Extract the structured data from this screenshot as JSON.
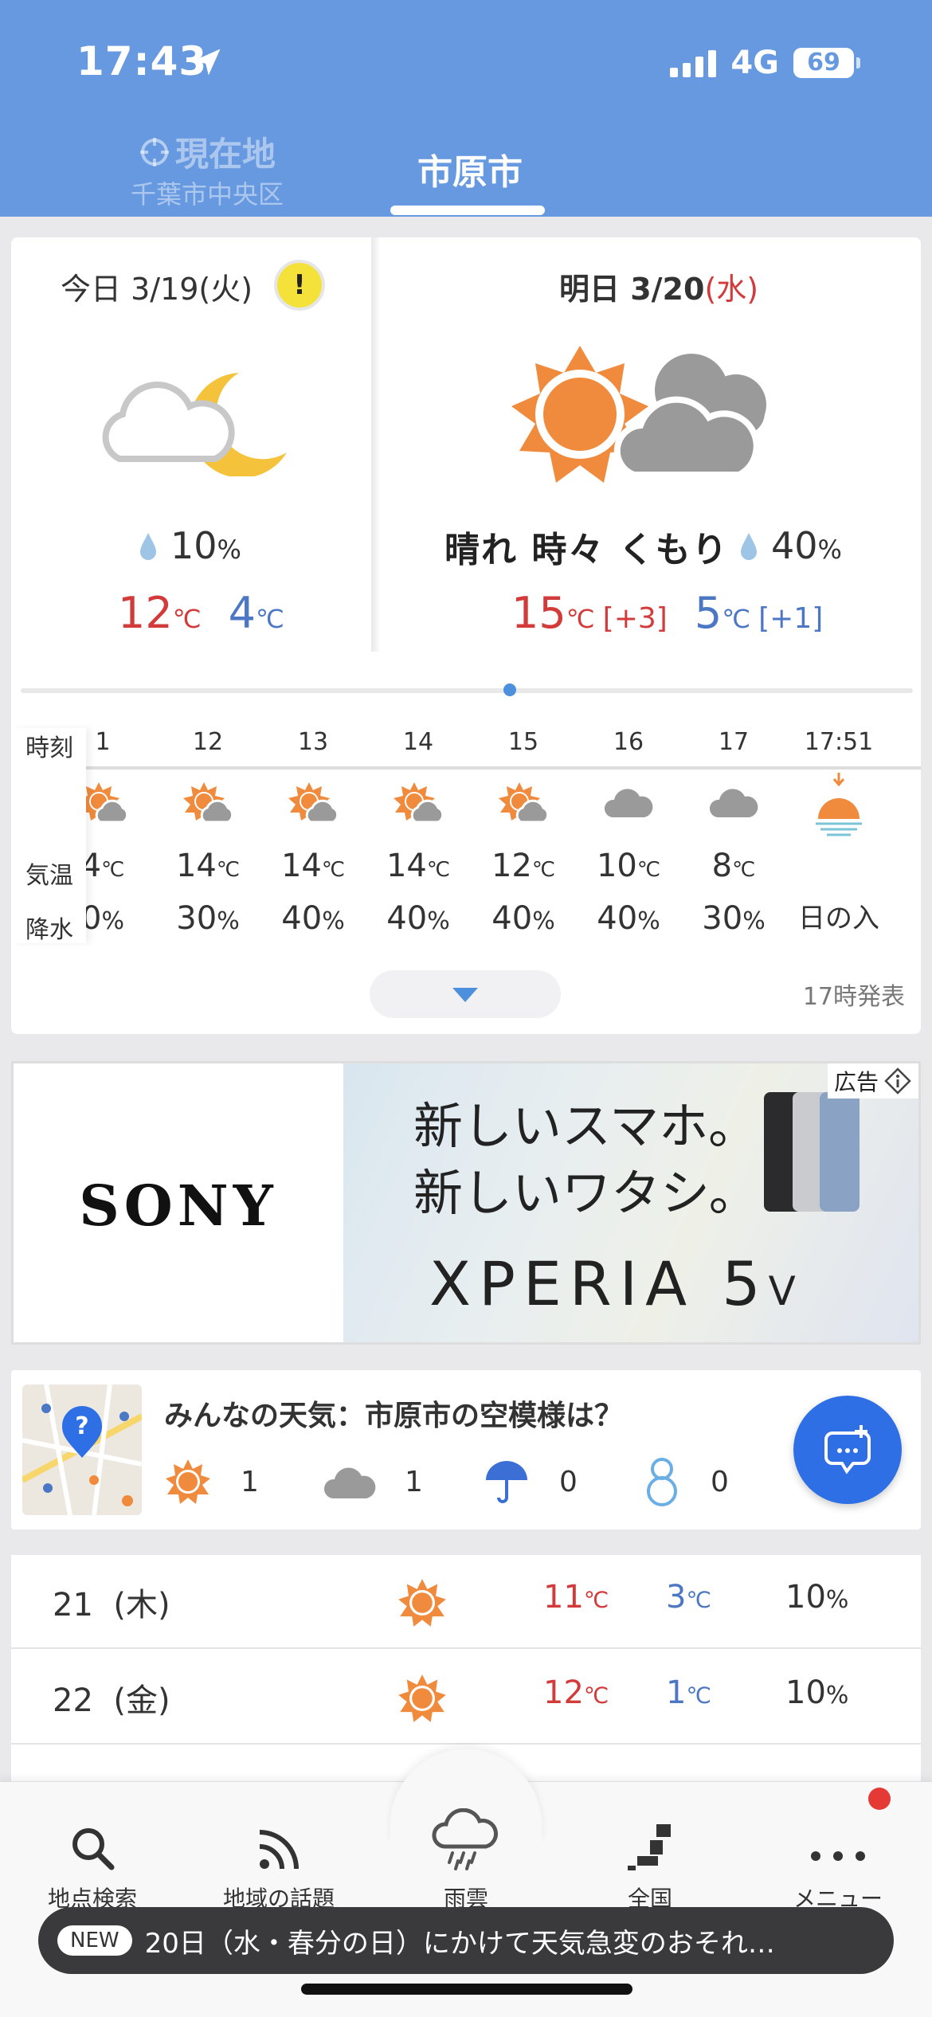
{
  "status_bar": {
    "time": "17:43",
    "network": "4G",
    "battery": "69"
  },
  "tabs": {
    "current_location_label": "現在地",
    "current_location_area": "千葉市中央区",
    "city_label": "市原市"
  },
  "today": {
    "date": "今日 3/19",
    "weekday": "(火)",
    "warning_mark": "!",
    "pop": "10",
    "pop_unit": "%",
    "high": "12",
    "low": "4",
    "temp_unit": "℃"
  },
  "tomorrow": {
    "date": "明日 3/20",
    "weekday": "(水)",
    "weather": "晴れ 時々 くもり",
    "pop": "40",
    "pop_unit": "%",
    "high": "15",
    "high_diff": "[+3]",
    "low": "5",
    "low_diff": "[+1]",
    "temp_unit": "℃"
  },
  "hourly": {
    "row_labels": {
      "time": "時刻",
      "temp": "気温",
      "precip": "降水"
    },
    "columns": [
      {
        "hour": "1",
        "icon": "sun-cloud",
        "temp": "4",
        "pop": "0"
      },
      {
        "hour": "12",
        "icon": "sun-cloud",
        "temp": "14",
        "pop": "30"
      },
      {
        "hour": "13",
        "icon": "sun-cloud",
        "temp": "14",
        "pop": "40"
      },
      {
        "hour": "14",
        "icon": "sun-cloud",
        "temp": "14",
        "pop": "40"
      },
      {
        "hour": "15",
        "icon": "sun-cloud",
        "temp": "12",
        "pop": "40"
      },
      {
        "hour": "16",
        "icon": "cloud",
        "temp": "10",
        "pop": "40"
      },
      {
        "hour": "17",
        "icon": "cloud",
        "temp": "8",
        "pop": "30"
      }
    ],
    "sunset": {
      "time": "17:51",
      "label": "日の入"
    },
    "issued": "17時発表"
  },
  "ad": {
    "badge": "広告",
    "brand": "SONY",
    "line1": "新しいスマホ。",
    "line2": "新しいワタシ。",
    "product": "XPERIA 5",
    "product_suffix": "V"
  },
  "community": {
    "title": "みんなの天気：市原市の空模様は？",
    "reports": [
      {
        "icon": "sun-icon",
        "count": "1"
      },
      {
        "icon": "cloud-icon",
        "count": "1"
      },
      {
        "icon": "umbrella-icon",
        "count": "0"
      },
      {
        "icon": "snowman-icon",
        "count": "0"
      }
    ]
  },
  "weekly": [
    {
      "day": "21",
      "weekday": "(木)",
      "icon": "sun",
      "high": "11",
      "low": "3",
      "pop": "10"
    },
    {
      "day": "22",
      "weekday": "(金)",
      "icon": "sun",
      "high": "12",
      "low": "1",
      "pop": "10"
    }
  ],
  "units": {
    "celsius": "℃",
    "percent": "%"
  },
  "bottom_nav": {
    "search": "地点検索",
    "topics": "地域の話題",
    "rain": "雨雲",
    "national": "全国",
    "menu": "メニュー"
  },
  "news": {
    "tag": "NEW",
    "text": "20日（水・春分の日）にかけて天気急変のおそれ…"
  },
  "colors": {
    "header": "#6699e0",
    "accent": "#2f6fe6",
    "sun": "#f08a3c",
    "high_temp": "#d33b3b",
    "low_temp": "#4c77c4"
  }
}
